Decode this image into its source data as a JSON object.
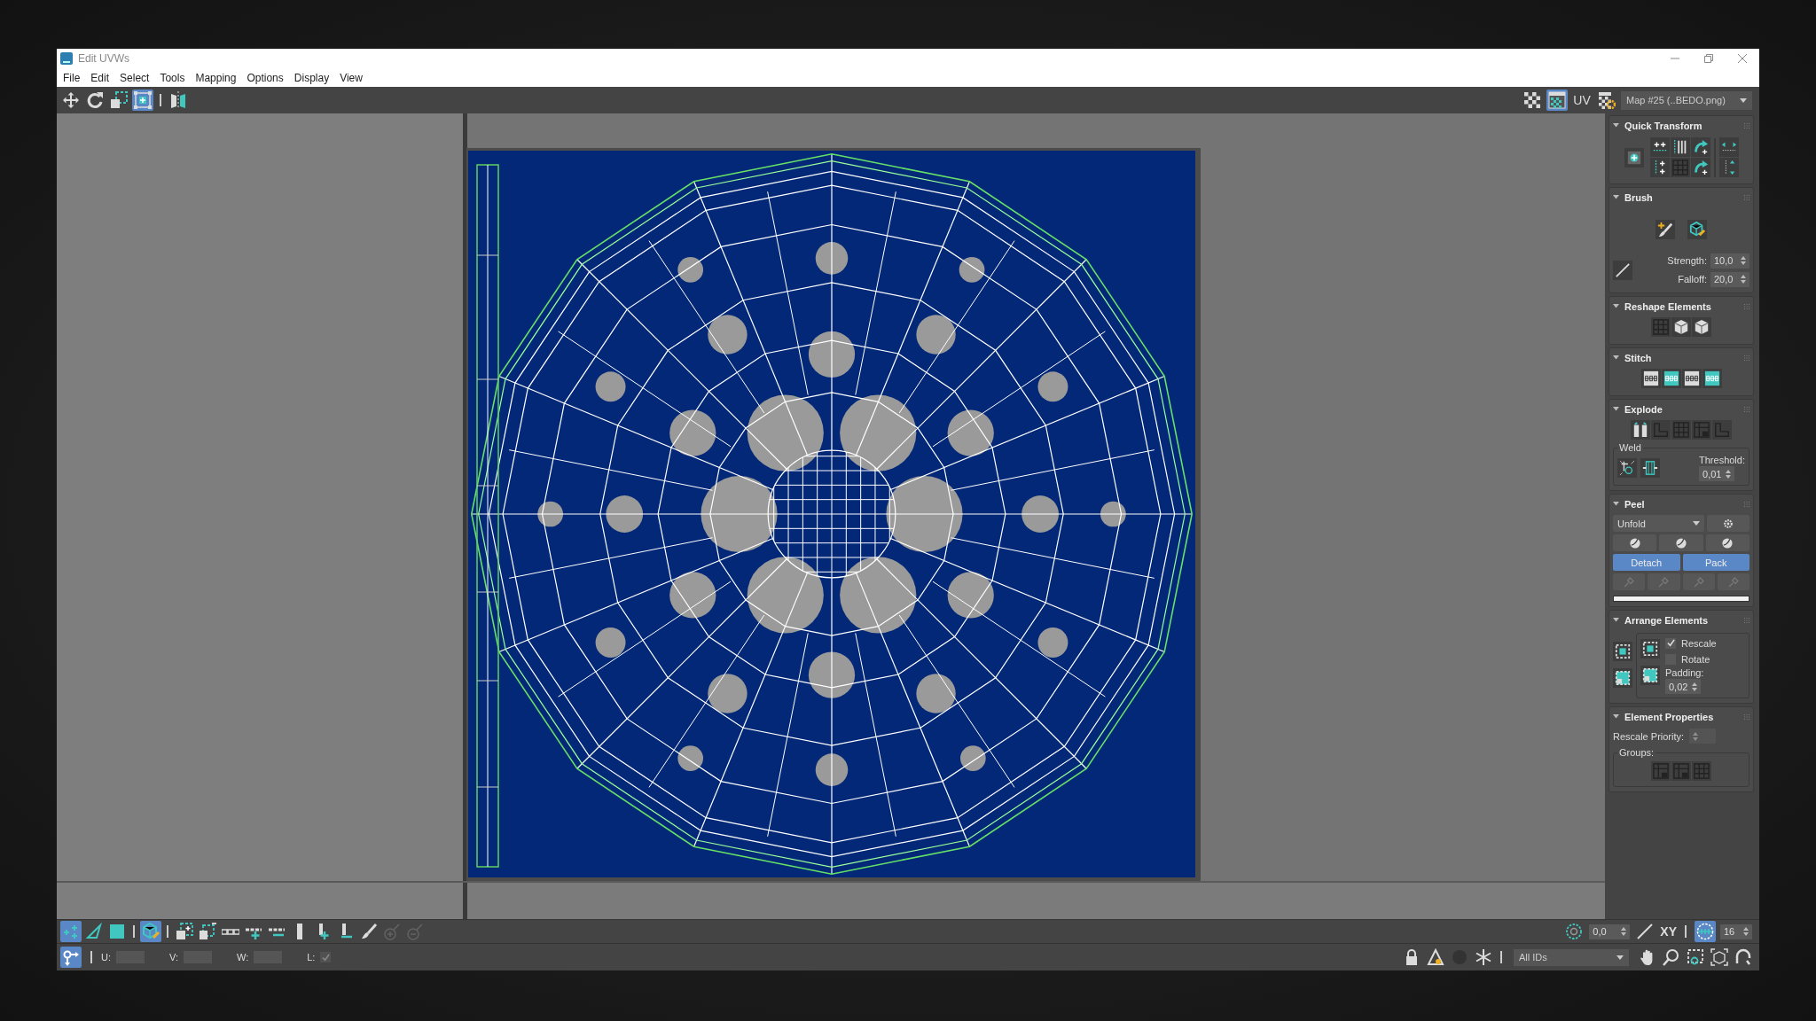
{
  "window": {
    "title": "Edit UVWs"
  },
  "menu": [
    "File",
    "Edit",
    "Select",
    "Tools",
    "Mapping",
    "Options",
    "Display",
    "View"
  ],
  "toolbar": {
    "tools": [
      {
        "selected": false
      },
      {
        "selected": false
      },
      {
        "selected": false
      },
      {
        "selected": true
      },
      {
        "selected": false
      }
    ],
    "view_tools": [
      {
        "selected": false
      },
      {
        "selected": true
      }
    ],
    "uv_button": "UV",
    "map_dropdown": "Map #25 (..BEDO.png)"
  },
  "panel": [
    {
      "kind": "quick_transform",
      "title": "Quick Transform",
      "expanded": true
    },
    {
      "kind": "brush",
      "title": "Brush",
      "expanded": true,
      "strength": {
        "label": "Strength:",
        "value": "10,0"
      },
      "falloff": {
        "label": "Falloff:",
        "value": "20,0"
      }
    },
    {
      "kind": "reshape",
      "title": "Reshape Elements",
      "expanded": true
    },
    {
      "kind": "stitch",
      "title": "Stitch",
      "expanded": true
    },
    {
      "kind": "explode",
      "title": "Explode",
      "expanded": true,
      "weld": {
        "title": "Weld",
        "threshold": {
          "label": "Threshold:",
          "value": "0,01"
        }
      }
    },
    {
      "kind": "peel",
      "title": "Peel",
      "expanded": true,
      "mode": "Unfold",
      "buttons": [
        "Detach",
        "Pack"
      ],
      "progress": {
        "level": 1
      }
    },
    {
      "kind": "arrange",
      "title": "Arrange Elements",
      "expanded": true,
      "options": [
        {
          "label": "Rescale",
          "checked": true
        },
        {
          "label": "Rotate",
          "checked": false
        }
      ],
      "padding": {
        "label": "Padding:",
        "value": "0,02"
      }
    },
    {
      "kind": "element_properties",
      "title": "Element Properties",
      "expanded": true,
      "rescale_priority": {
        "label": "Rescale Priority:"
      },
      "groups": {
        "title": "Groups:"
      }
    }
  ],
  "bottom_toolbar": {
    "tools": [
      {
        "selected": true,
        "disabled": false
      },
      {
        "selected": false,
        "disabled": false
      },
      {
        "selected": false,
        "disabled": false
      },
      {
        "selected": true,
        "disabled": false
      },
      {
        "selected": false,
        "disabled": false
      },
      {
        "selected": false,
        "disabled": false
      },
      {
        "selected": false,
        "disabled": false
      },
      {
        "selected": false,
        "disabled": false
      },
      {
        "selected": false,
        "disabled": false
      },
      {
        "selected": false,
        "disabled": false
      },
      {
        "selected": false,
        "disabled": false
      },
      {
        "selected": false,
        "disabled": false
      },
      {
        "selected": false,
        "disabled": false
      },
      {
        "selected": false,
        "disabled": true
      },
      {
        "selected": false,
        "disabled": true
      }
    ],
    "soft_selection": {
      "value": "0,0"
    },
    "axis": {
      "label": "XY"
    },
    "grid_snap": {
      "selected": true
    },
    "grid_size": {
      "value": "16"
    }
  },
  "status_row": {
    "pivot": {
      "selected": true
    },
    "coords": [
      {
        "label": "U:"
      },
      {
        "label": "V:"
      },
      {
        "label": "W:"
      }
    ],
    "lock_uv": {
      "label": "L:",
      "checked": true
    },
    "id_filter": "All IDs"
  }
}
